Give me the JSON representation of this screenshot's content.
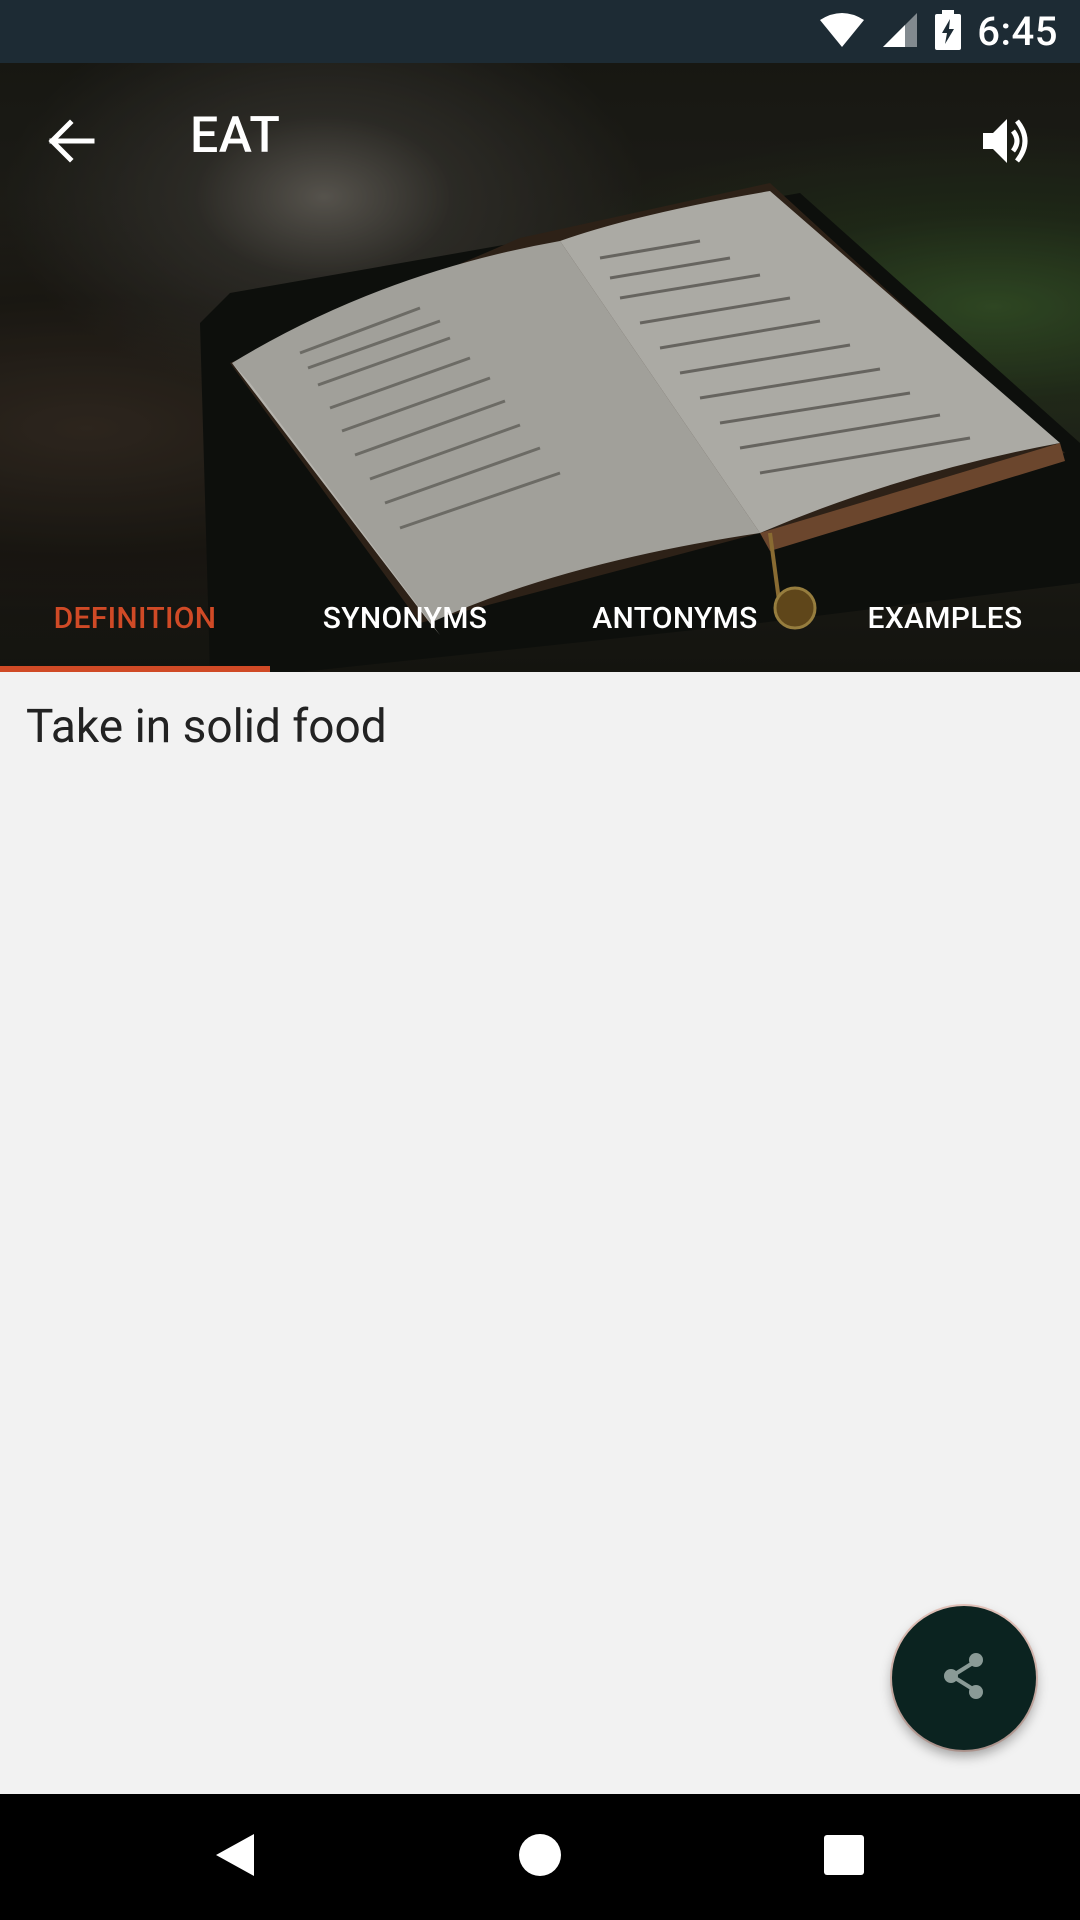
{
  "status_bar": {
    "time": "6:45",
    "icons": [
      "wifi-icon",
      "signal-icon",
      "battery-charging-icon"
    ]
  },
  "app_bar": {
    "title": "EAT",
    "back_icon": "arrow-back-icon",
    "speaker_icon": "volume-up-icon"
  },
  "tabs": [
    {
      "label": "DEFINITION",
      "active": true
    },
    {
      "label": "SYNONYMS",
      "active": false
    },
    {
      "label": "ANTONYMS",
      "active": false
    },
    {
      "label": "EXAMPLES",
      "active": false
    }
  ],
  "content": {
    "definition": "Take in solid food"
  },
  "fab": {
    "icon": "share-icon"
  },
  "nav_bar": {
    "icons": [
      "nav-back-icon",
      "nav-home-icon",
      "nav-recents-icon"
    ]
  },
  "colors": {
    "accent": "#d04a26",
    "status_bar": "#1d2b34",
    "fab": "#0b2320",
    "background": "#f2f2f2"
  }
}
